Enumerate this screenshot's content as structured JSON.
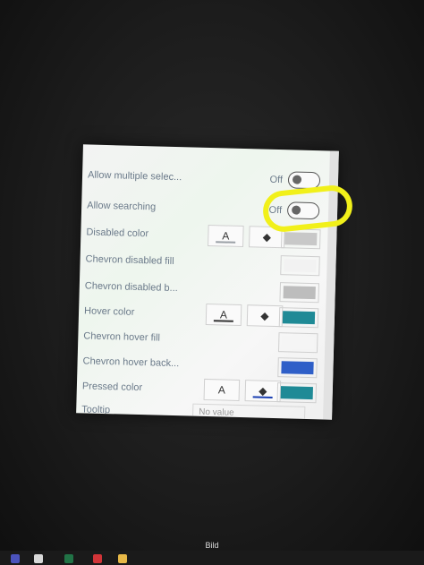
{
  "background": {
    "title": "",
    "subtitle": ""
  },
  "panel": {
    "rows": [
      {
        "label": "Allow multiple selec...",
        "type": "toggle",
        "state": "Off"
      },
      {
        "label": "Allow searching",
        "type": "toggle",
        "state": "Off"
      },
      {
        "label": "Disabled color",
        "type": "color",
        "a": "A",
        "swatch": "#c8c8c8",
        "underline": "#9aa0a6"
      },
      {
        "label": "Chevron disabled fill",
        "type": "swatch",
        "swatch": "#f2f2f2"
      },
      {
        "label": "Chevron disabled b...",
        "type": "swatch",
        "swatch": "#bdbdbd"
      },
      {
        "label": "Hover color",
        "type": "color",
        "a": "A",
        "swatch": "#1f8a96",
        "underline": "#333333"
      },
      {
        "label": "Chevron hover fill",
        "type": "swatch",
        "swatch": "#f5f5f5"
      },
      {
        "label": "Chevron hover back...",
        "type": "swatch",
        "swatch": "#2f5fc8"
      },
      {
        "label": "Pressed color",
        "type": "color",
        "a": "A",
        "swatch": "#1f8a96",
        "underline": "#1a3fb2"
      },
      {
        "label": "Tooltip",
        "type": "text",
        "value": "No value"
      }
    ]
  },
  "caption": "Bild",
  "colors": {
    "highlight": "#f1f01a"
  }
}
